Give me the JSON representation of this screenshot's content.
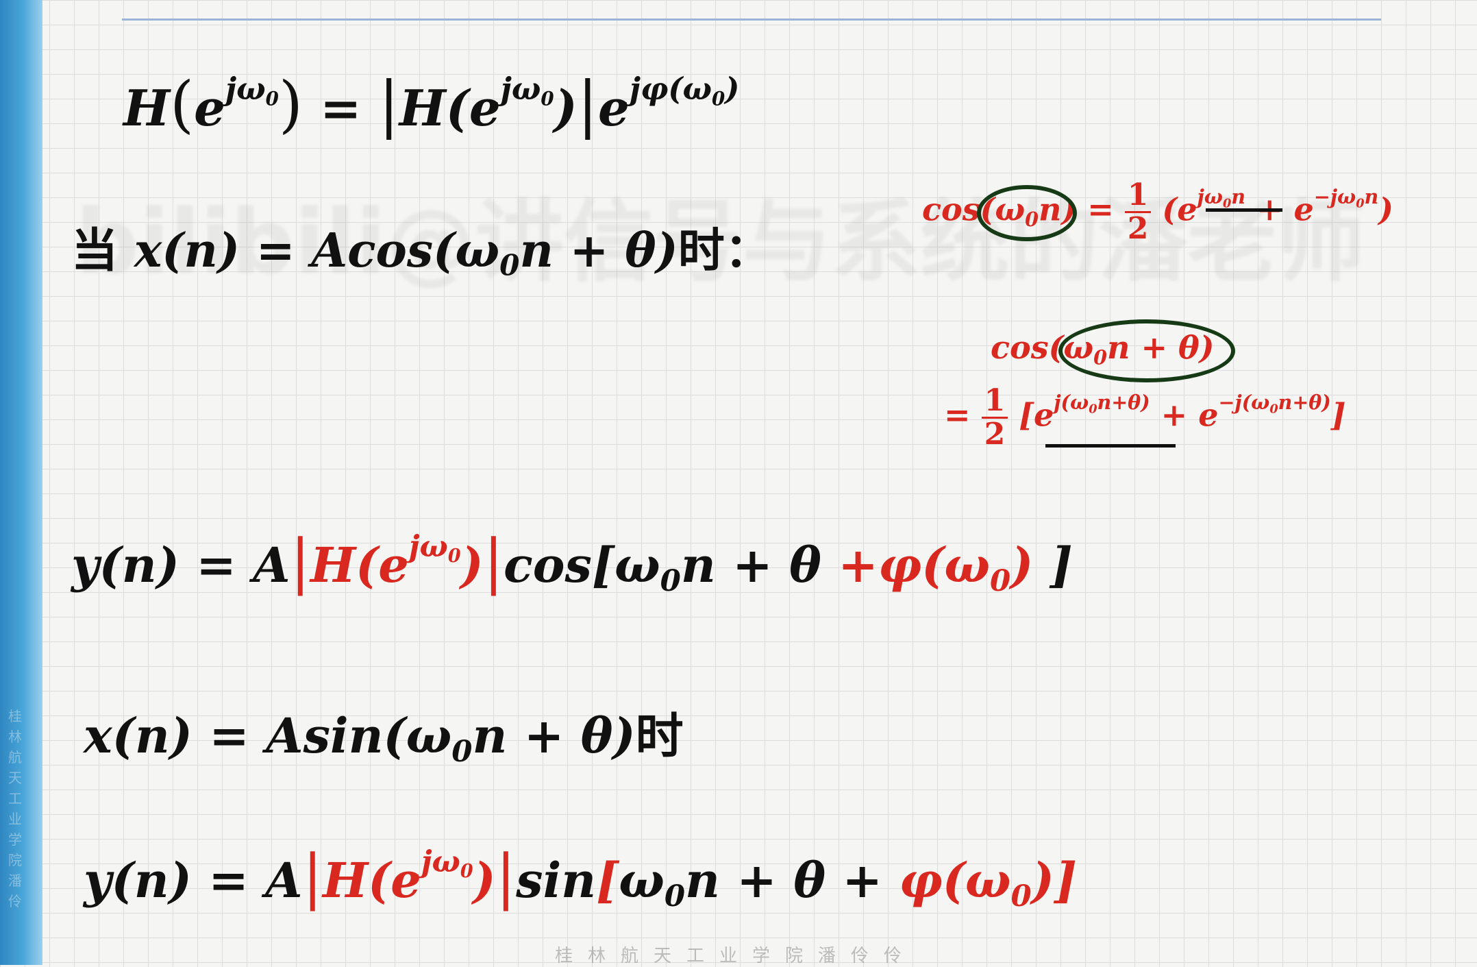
{
  "sidebar": {
    "vertical_text": "桂林航天工业学院潘伶"
  },
  "watermark": "bilibili@讲信号与系统的潘老师",
  "footer": "桂林航天工业学院潘伶伶",
  "formulas": {
    "f1": {
      "text": "H(e^{jω₀}) = |H(e^{jω₀})| e^{jφ(ω₀)}"
    },
    "f2": {
      "prefix": "当",
      "suffix": "时：",
      "text": "x(n) = Acos(ω₀n + θ)"
    },
    "note1": {
      "text": "cos(ω₀n) = ½ (e^{jω₀n} + e^{−jω₀n})"
    },
    "note2": {
      "text": "cos(ω₀n + θ) = ½ [e^{j(ω₀n+θ)} + e^{−j(ω₀n+θ)}]"
    },
    "f3": {
      "text": "y(n) = A|H(e^{jω₀})| cos[ω₀n + θ + φ(ω₀)]"
    },
    "f4": {
      "suffix": "时",
      "text": "x(n) = Asin(ω₀n + θ)"
    },
    "f5": {
      "text": "y(n) = A|H(e^{jω₀})| sin[ω₀n + θ + φ(ω₀)]"
    }
  },
  "fraction": {
    "num": "1",
    "den": "2"
  },
  "colors": {
    "accent_red": "#d9281f",
    "oval_green": "#163a16",
    "sidebar_blue": "#4aa6d8"
  }
}
